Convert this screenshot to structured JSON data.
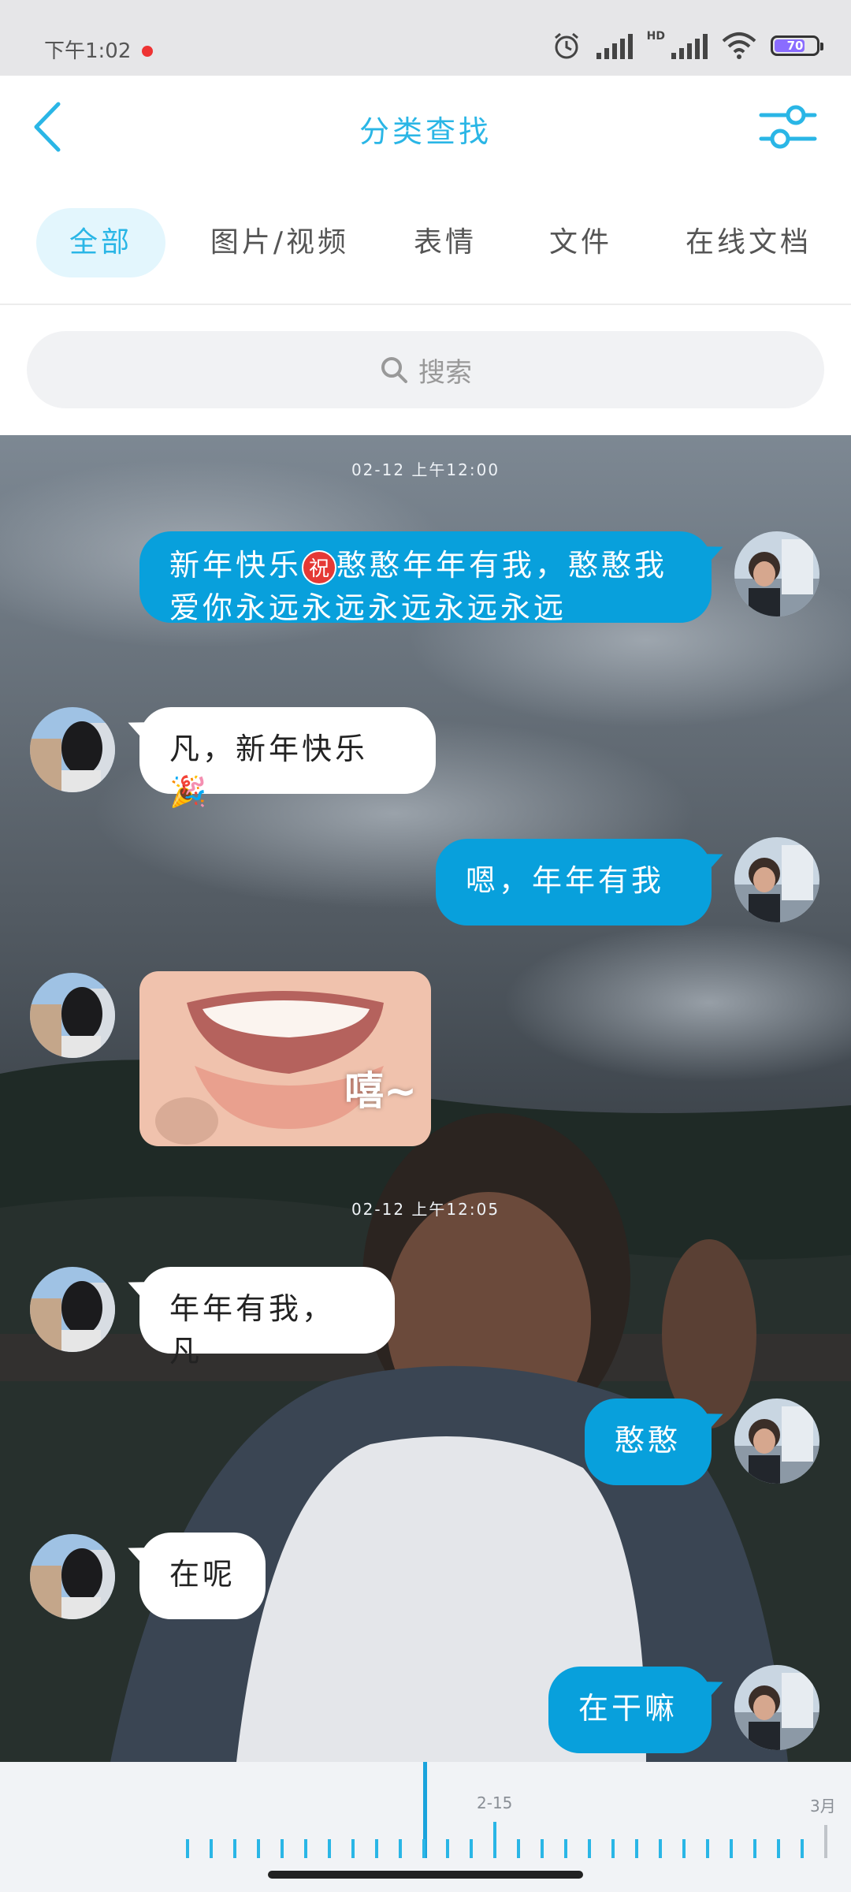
{
  "status_bar": {
    "time": "下午1:02",
    "battery": "70",
    "network_label": "HD"
  },
  "header": {
    "title": "分类查找"
  },
  "tabs": [
    {
      "label": "全部",
      "active": true
    },
    {
      "label": "图片/视频",
      "active": false
    },
    {
      "label": "表情",
      "active": false
    },
    {
      "label": "文件",
      "active": false
    },
    {
      "label": "在线文档",
      "active": false
    }
  ],
  "search": {
    "placeholder": "搜索"
  },
  "chat": {
    "timestamps": [
      "02-12 上午12:00",
      "02-12 上午12:05"
    ],
    "messages": [
      {
        "sender": "me",
        "text_before": "新年快乐",
        "badge": "祝",
        "text_after": "憨憨年年有我，憨憨我爱你永远永远永远永远永远"
      },
      {
        "sender": "them",
        "text": "凡，新年快乐🎉"
      },
      {
        "sender": "me",
        "text": "嗯，年年有我"
      },
      {
        "sender": "them",
        "sticker_text": "嘻~"
      },
      {
        "sender": "them",
        "text": "年年有我，凡"
      },
      {
        "sender": "me",
        "text": "憨憨"
      },
      {
        "sender": "them",
        "text": "在呢"
      },
      {
        "sender": "me",
        "text": "在干嘛"
      }
    ]
  },
  "timeline": {
    "labels": [
      "2-15",
      "3月"
    ]
  },
  "colors": {
    "accent": "#2ab6e6",
    "bubble_me": "#08a0dc",
    "bubble_them": "#ffffff"
  },
  "icons": [
    "back-arrow-icon",
    "filter-sliders-icon",
    "search-icon",
    "alarm-icon",
    "signal-icon",
    "wifi-icon",
    "battery-icon"
  ]
}
